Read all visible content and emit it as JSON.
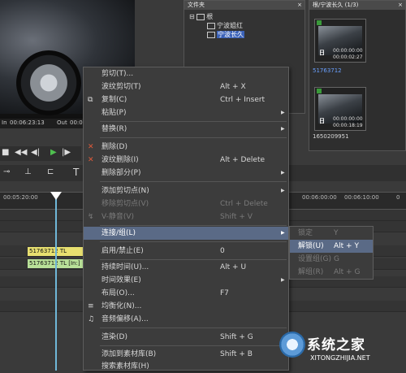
{
  "preview": {
    "in_label": "In",
    "in_tc": "00:06:23:13",
    "out_label": "Out",
    "out_tc": "00:06:2"
  },
  "folder_panel": {
    "title": "文件夹",
    "close": "×",
    "root": "根",
    "items": [
      "宁波姐红",
      "宁波长久"
    ]
  },
  "bin_panel": {
    "title": "根/宁波长久 (1/3)",
    "close": "×",
    "thumbs": [
      {
        "day": "日",
        "tc1": "00:00:00:00",
        "tc2": "00:00:02:27",
        "name": "51763712"
      },
      {
        "day": "日",
        "tc1": "00:00:00:00",
        "tc2": "00:00:18:19",
        "name": "1650209951"
      }
    ]
  },
  "ruler": {
    "labels": [
      "00:05:20:00",
      "00:06:00:00",
      "00:06:10:00",
      "0"
    ]
  },
  "timeline": {
    "clip1": "51763712  TL",
    "clip2": "51763712  TL [In:]"
  },
  "context_menu": {
    "cut": {
      "label": "剪切(T)...",
      "shortcut": ""
    },
    "ripple_cut": {
      "label": "波纹剪切(T)",
      "shortcut": "Alt + X"
    },
    "copy": {
      "label": "复制(C)",
      "shortcut": "Ctrl + Insert"
    },
    "paste": {
      "label": "粘贴(P)",
      "shortcut": ""
    },
    "replace": {
      "label": "替换(R)",
      "shortcut": ""
    },
    "delete": {
      "label": "删除(D)",
      "shortcut": ""
    },
    "ripple_delete": {
      "label": "波纹删除(I)",
      "shortcut": "Alt + Delete"
    },
    "delete_part": {
      "label": "删除部分(P)",
      "shortcut": ""
    },
    "add_cut_point": {
      "label": "添加剪切点(N)",
      "shortcut": ""
    },
    "remove_cut_point": {
      "label": "移除剪切点(V)",
      "shortcut": "Ctrl + Delete"
    },
    "v_mute": {
      "label": "V-静音(V)",
      "shortcut": "Shift + V"
    },
    "link_group": {
      "label": "连接/组(L)",
      "shortcut": ""
    },
    "enable_disable": {
      "label": "启用/禁止(E)",
      "shortcut": "0"
    },
    "duration": {
      "label": "持续时间(U)...",
      "shortcut": "Alt + U"
    },
    "time_effect": {
      "label": "时间效果(E)",
      "shortcut": ""
    },
    "layout": {
      "label": "布局(O)...",
      "shortcut": "F7"
    },
    "equalize": {
      "label": "均衡化(N)...",
      "shortcut": ""
    },
    "audio_offset": {
      "label": "音频偏移(A)...",
      "shortcut": ""
    },
    "render": {
      "label": "渲染(D)",
      "shortcut": "Shift + G"
    },
    "add_to_bin": {
      "label": "添加到素材库(B)",
      "shortcut": "Shift + B"
    },
    "search_bin": {
      "label": "搜索素材库(H)",
      "shortcut": ""
    }
  },
  "submenu": {
    "lock": {
      "label": "锁定",
      "shortcut": "Y"
    },
    "unlock": {
      "label": "解锁(U)",
      "shortcut": "Alt + Y"
    },
    "set_group": {
      "label": "设置组(G)",
      "shortcut": "G"
    },
    "ungroup": {
      "label": "解组(R)",
      "shortcut": "Alt + G"
    }
  },
  "watermark": {
    "main": "系统之家",
    "sub": "XITONGZHIJIA.NET"
  },
  "colors": {
    "menu_bg": "#3c3c3c",
    "highlight": "#5a6a86",
    "playhead": "#6fb7d8",
    "clip_yellow": "#e8e070",
    "clip_green": "#b8e098"
  }
}
